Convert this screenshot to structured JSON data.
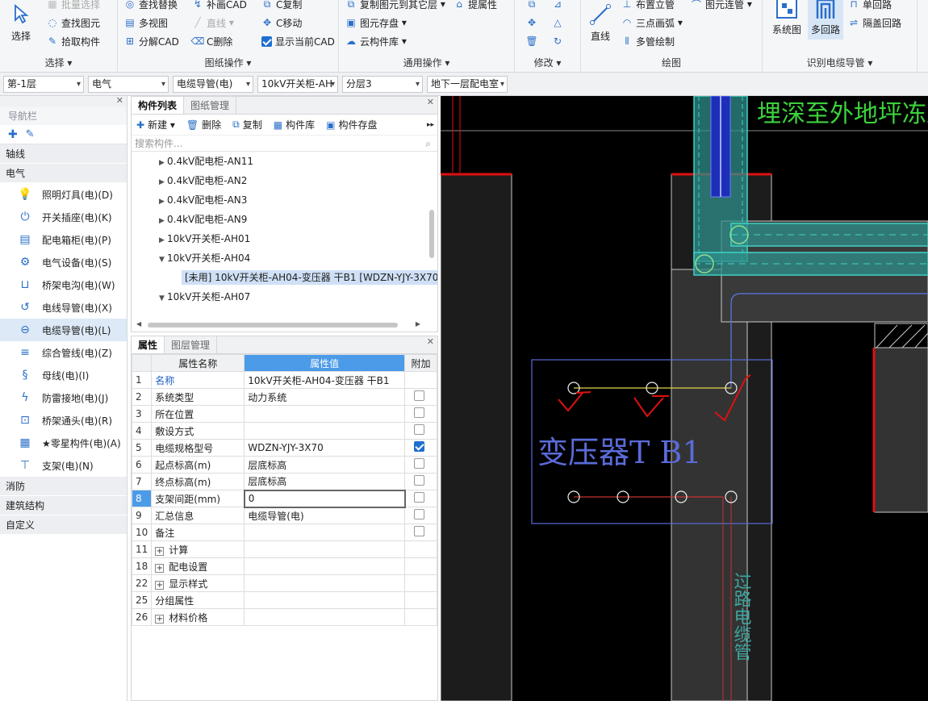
{
  "ribbon": {
    "select_group": {
      "title": "选择",
      "big_label": "选择",
      "items": [
        "批量选择",
        "查找图元",
        "拾取构件"
      ]
    },
    "drawing_ops": {
      "title": "图纸操作",
      "items": [
        "查找替换",
        "补画CAD",
        "C复制",
        "多视图",
        "直线",
        "C移动",
        "分解CAD",
        "C删除",
        "显示当前CAD"
      ],
      "show_current_cad_checked": true
    },
    "common_ops": {
      "title": "通用操作",
      "items": [
        "复制图元到其它层",
        "提属性",
        "图元存盘",
        "云构件库"
      ]
    },
    "modify": {
      "title": "修改"
    },
    "draw": {
      "title": "绘图",
      "big_label": "直线",
      "items": [
        "布置立管",
        "图元连管",
        "三点画弧",
        "多管绘制"
      ]
    },
    "recognize": {
      "title": "识别电缆导管",
      "big_items": [
        "系统图",
        "多回路"
      ],
      "items": [
        "单回路",
        "隔盖回路"
      ]
    }
  },
  "selectors": [
    "第-1层",
    "电气",
    "电缆导管(电)",
    "10kV开关柜-AH",
    "分层3",
    "地下一层配电室"
  ],
  "nav": {
    "title": "导航栏",
    "categories_top": [
      "轴线",
      "电气"
    ],
    "items": [
      {
        "label": "照明灯具(电)(D)",
        "icon": "bulb-icon"
      },
      {
        "label": "开关插座(电)(K)",
        "icon": "switch-icon"
      },
      {
        "label": "配电箱柜(电)(P)",
        "icon": "panel-icon"
      },
      {
        "label": "电气设备(电)(S)",
        "icon": "device-icon"
      },
      {
        "label": "桥架电沟(电)(W)",
        "icon": "tray-icon"
      },
      {
        "label": "电线导管(电)(X)",
        "icon": "wire-conduit-icon"
      },
      {
        "label": "电缆导管(电)(L)",
        "icon": "cable-conduit-icon"
      },
      {
        "label": "综合管线(电)(Z)",
        "icon": "combined-pipe-icon"
      },
      {
        "label": "母线(电)(I)",
        "icon": "busbar-icon"
      },
      {
        "label": "防雷接地(电)(J)",
        "icon": "lightning-icon"
      },
      {
        "label": "桥架通头(电)(R)",
        "icon": "tray-fitting-icon"
      },
      {
        "label": "★零星构件(电)(A)",
        "icon": "misc-icon"
      },
      {
        "label": "支架(电)(N)",
        "icon": "bracket-icon"
      }
    ],
    "categories_bottom": [
      "消防",
      "建筑结构",
      "自定义"
    ]
  },
  "complist": {
    "tabs": [
      "构件列表",
      "图纸管理"
    ],
    "toolbar": [
      "新建",
      "删除",
      "复制",
      "构件库",
      "构件存盘"
    ],
    "search_placeholder": "搜索构件...",
    "tree": [
      {
        "label": "0.4kV配电柜-AN11",
        "expanded": false,
        "level": 1
      },
      {
        "label": "0.4kV配电柜-AN2",
        "expanded": false,
        "level": 1
      },
      {
        "label": "0.4kV配电柜-AN3",
        "expanded": false,
        "level": 1
      },
      {
        "label": "0.4kV配电柜-AN9",
        "expanded": false,
        "level": 1
      },
      {
        "label": "10kV开关柜-AH01",
        "expanded": false,
        "level": 1
      },
      {
        "label": "10kV开关柜-AH04",
        "expanded": true,
        "level": 1
      },
      {
        "label": "[未用] 10kV开关柜-AH04-变压器 干B1 [WDZN-YJY-3X70",
        "expanded": false,
        "level": 2,
        "selected": true
      },
      {
        "label": "10kV开关柜-AH07",
        "expanded": true,
        "level": 1
      }
    ]
  },
  "props": {
    "tabs": [
      "属性",
      "图层管理"
    ],
    "headers": [
      "属性名称",
      "属性值",
      "附加"
    ],
    "rows": [
      {
        "num": "1",
        "name": "名称",
        "value": "10kV开关柜-AH04-变压器 干B1",
        "check": null,
        "blue": true
      },
      {
        "num": "2",
        "name": "系统类型",
        "value": "动力系统",
        "check": false,
        "blue": false
      },
      {
        "num": "3",
        "name": "所在位置",
        "value": "",
        "check": false,
        "blue": false
      },
      {
        "num": "4",
        "name": "敷设方式",
        "value": "",
        "check": false,
        "blue": false
      },
      {
        "num": "5",
        "name": "电缆规格型号",
        "value": "WDZN-YJY-3X70",
        "check": true,
        "blue": false
      },
      {
        "num": "6",
        "name": "起点标高(m)",
        "value": "层底标高",
        "check": false,
        "blue": false
      },
      {
        "num": "7",
        "name": "终点标高(m)",
        "value": "层底标高",
        "check": false,
        "blue": false
      },
      {
        "num": "8",
        "name": "支架间距(mm)",
        "value": "0",
        "check": false,
        "blue": false,
        "editing": true
      },
      {
        "num": "9",
        "name": "汇总信息",
        "value": "电缆导管(电)",
        "check": false,
        "blue": false
      },
      {
        "num": "10",
        "name": "备注",
        "value": "",
        "check": false,
        "blue": false
      },
      {
        "num": "11",
        "name": "计算",
        "value": "",
        "check": null,
        "group": true
      },
      {
        "num": "18",
        "name": "配电设置",
        "value": "",
        "check": null,
        "group": true
      },
      {
        "num": "22",
        "name": "显示样式",
        "value": "",
        "check": null,
        "group": true
      },
      {
        "num": "25",
        "name": "分组属性",
        "value": "",
        "check": null
      },
      {
        "num": "26",
        "name": "材料价格",
        "value": "",
        "check": null,
        "group": true
      }
    ]
  },
  "cad": {
    "top_text": "埋深至外地坪冻土层以下",
    "label_transformer": "变压器T B1",
    "label_vertical": "过路电缆管",
    "colors": {
      "duct": "#3fd2c4",
      "red": "#e01010",
      "wall": "#c8c8c8",
      "blue_frame": "#5a6bd8"
    }
  }
}
